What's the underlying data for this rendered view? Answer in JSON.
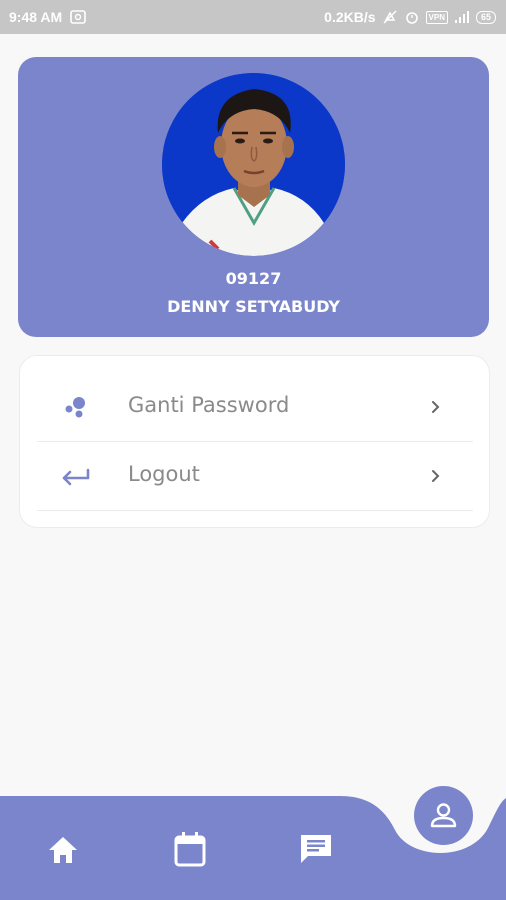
{
  "status_bar": {
    "time": "9:48 AM",
    "network_speed": "0.2KB/s",
    "vpn": "VPN",
    "battery": "65"
  },
  "profile": {
    "id": "09127",
    "name": "DENNY SETYABUDY"
  },
  "menu": [
    {
      "label": "Ganti Password",
      "icon": "bubbles-icon"
    },
    {
      "label": "Logout",
      "icon": "logout-arrow-icon"
    }
  ],
  "bottom_nav": {
    "items": [
      "home-icon",
      "calendar-icon",
      "chat-icon"
    ],
    "fab_icon": "profile-icon"
  },
  "colors": {
    "accent": "#7a85cb",
    "avatar_background": "#0b38c9",
    "status_bar": "#c6c6c6",
    "page_background": "#f8f8f8"
  }
}
